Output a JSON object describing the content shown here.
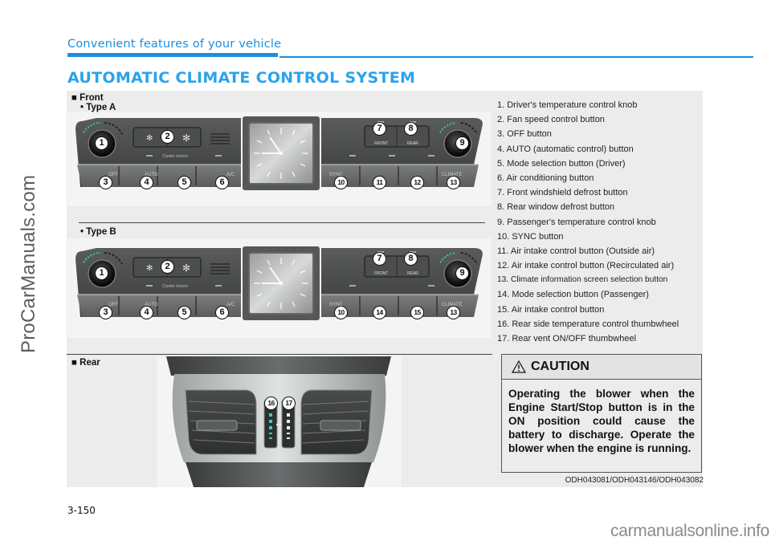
{
  "watermarks": {
    "side": "ProCarManuals.com",
    "bottom": "carmanualsonline.info"
  },
  "header": {
    "section": "Convenient features of your vehicle",
    "title": "AUTOMATIC CLIMATE CONTROL SYSTEM",
    "accent_color": "#1b8fde"
  },
  "figure": {
    "front_label": "■ Front",
    "type_a_label": "• Type A",
    "type_b_label": "• Type B",
    "rear_label": "■ Rear",
    "panel_text": {
      "ionizer": "Cluster Ionizer",
      "front": "FRONT",
      "rear": "REAR",
      "off": "OFF",
      "auto": "AUTO",
      "ac": "A/C",
      "sync": "SYNC",
      "climate": "CLIMATE"
    },
    "type_a_callouts": [
      "1",
      "2",
      "3",
      "4",
      "5",
      "6",
      "7",
      "8",
      "9",
      "10",
      "11",
      "12",
      "13"
    ],
    "type_b_callouts": [
      "1",
      "2",
      "3",
      "4",
      "5",
      "6",
      "7",
      "8",
      "9",
      "10",
      "14",
      "15",
      "13"
    ],
    "rear_callouts": [
      "16",
      "17"
    ],
    "image_code": "ODH043081/ODH043146/ODH043082"
  },
  "legend": [
    "1. Driver's temperature control knob",
    "2. Fan speed control button",
    "3. OFF button",
    "4. AUTO (automatic control) button",
    "5. Mode selection button (Driver)",
    "6. Air conditioning button",
    "7. Front windshield defrost button",
    "8. Rear window defrost button",
    "9. Passenger's temperature control knob",
    "10. SYNC button",
    "11. Air intake control button (Outside air)",
    "12. Air intake control button (Recirculated air)",
    "13. Climate information screen selection button",
    "14. Mode selection button (Passenger)",
    "15. Air intake control button",
    "16. Rear side temperature control thumbwheel",
    "17. Rear vent ON/OFF thumbwheel"
  ],
  "caution": {
    "icon": "warning-triangle-icon",
    "title": "CAUTION",
    "body": "Operating the blower when the Engine Start/Stop button is in the ON position could cause the battery to discharge. Operate the blower when the engine is running."
  },
  "page_number": "3-150"
}
